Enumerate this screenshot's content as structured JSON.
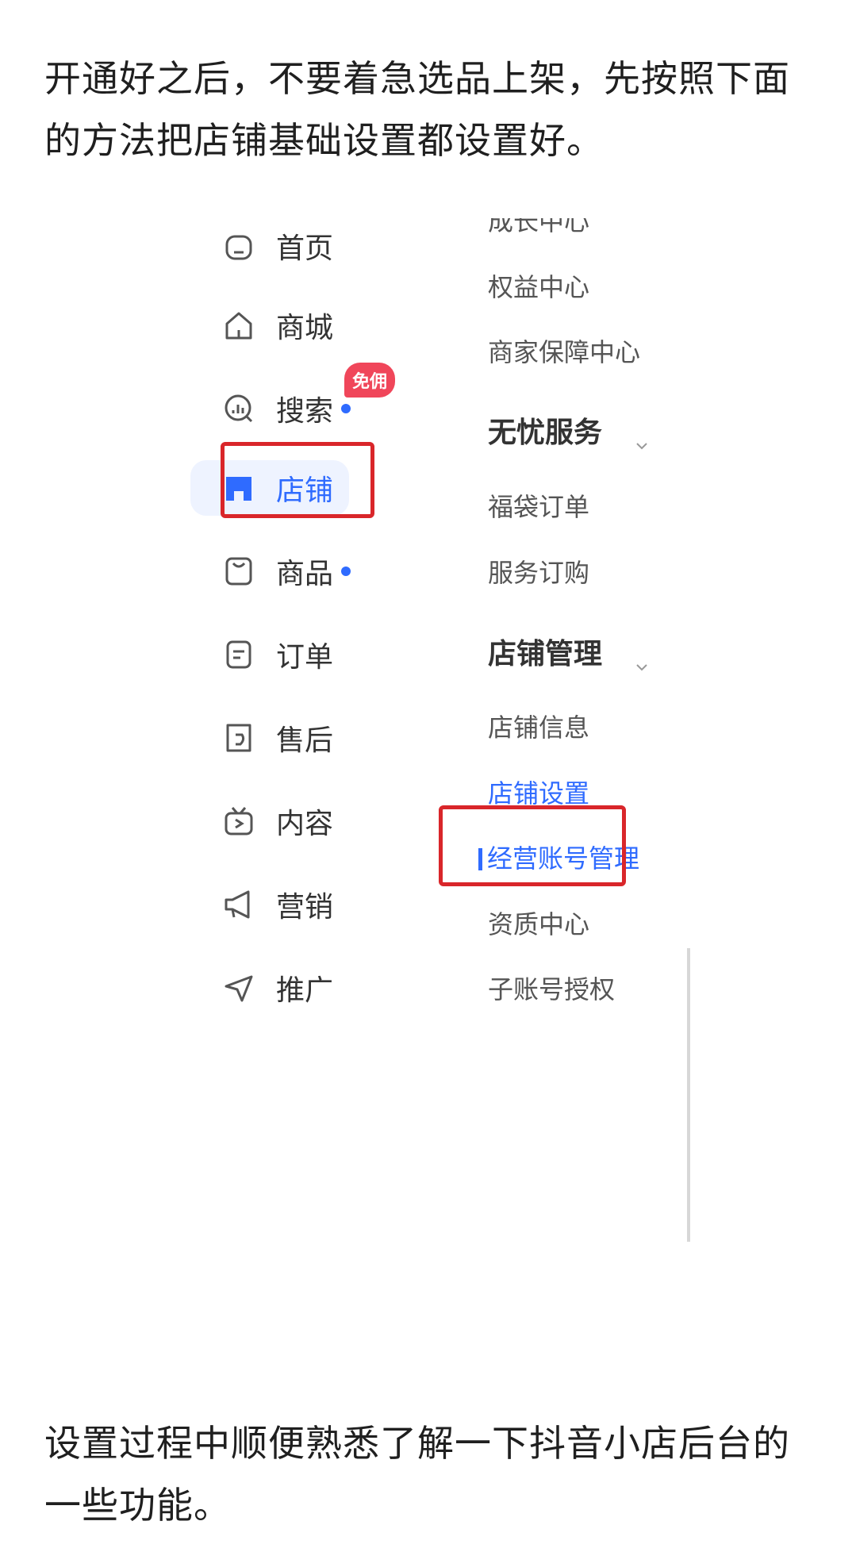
{
  "intro_text": "开通好之后，不要着急选品上架，先按照下面的方法把店铺基础设置都设置好。",
  "outro_text": "设置过程中顺便熟悉了解一下抖音小店后台的一些功能。",
  "sidebar": {
    "items": [
      {
        "label": "首页",
        "icon": "home-icon"
      },
      {
        "label": "商城",
        "icon": "mall-icon",
        "badge": "免佣"
      },
      {
        "label": "搜索",
        "icon": "search-icon",
        "dot": true
      },
      {
        "label": "店铺",
        "icon": "store-icon",
        "active": true
      },
      {
        "label": "商品",
        "icon": "product-icon",
        "dot": true
      },
      {
        "label": "订单",
        "icon": "order-icon"
      },
      {
        "label": "售后",
        "icon": "aftersale-icon"
      },
      {
        "label": "内容",
        "icon": "content-icon"
      },
      {
        "label": "营销",
        "icon": "marketing-icon"
      },
      {
        "label": "推广",
        "icon": "promotion-icon"
      }
    ]
  },
  "submenu": {
    "items": [
      "成长中心",
      "权益中心",
      "商家保障中心"
    ],
    "group1": {
      "title": "无忧服务",
      "items": [
        "福袋订单",
        "服务订购"
      ]
    },
    "group2": {
      "title": "店铺管理",
      "items": [
        "店铺信息",
        "店铺设置",
        "经营账号管理",
        "资质中心",
        "子账号授权"
      ]
    }
  },
  "colors": {
    "accent": "#2f6bff",
    "highlight": "#d9262a",
    "badge": "#f0465a"
  }
}
